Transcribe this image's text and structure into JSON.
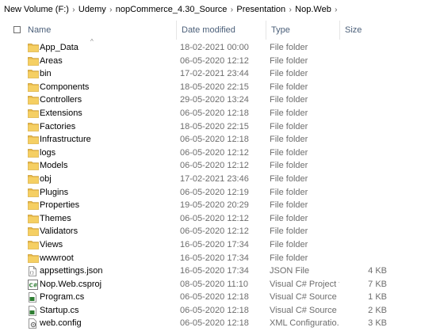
{
  "breadcrumb": [
    "New Volume (F:)",
    "Udemy",
    "nopCommerce_4.30_Source",
    "Presentation",
    "Nop.Web"
  ],
  "columns": {
    "name": "Name",
    "date": "Date modified",
    "type": "Type",
    "size": "Size"
  },
  "colors": {
    "folder": "#e8b94a",
    "header_text": "#4c607a",
    "meta_text": "#6d6d6d"
  },
  "files": [
    {
      "name": "App_Data",
      "date": "18-02-2021 00:00",
      "type": "File folder",
      "size": "",
      "icon": "folder-icon"
    },
    {
      "name": "Areas",
      "date": "06-05-2020 12:12",
      "type": "File folder",
      "size": "",
      "icon": "folder-icon"
    },
    {
      "name": "bin",
      "date": "17-02-2021 23:44",
      "type": "File folder",
      "size": "",
      "icon": "folder-icon"
    },
    {
      "name": "Components",
      "date": "18-05-2020 22:15",
      "type": "File folder",
      "size": "",
      "icon": "folder-icon"
    },
    {
      "name": "Controllers",
      "date": "29-05-2020 13:24",
      "type": "File folder",
      "size": "",
      "icon": "folder-icon"
    },
    {
      "name": "Extensions",
      "date": "06-05-2020 12:18",
      "type": "File folder",
      "size": "",
      "icon": "folder-icon"
    },
    {
      "name": "Factories",
      "date": "18-05-2020 22:15",
      "type": "File folder",
      "size": "",
      "icon": "folder-icon"
    },
    {
      "name": "Infrastructure",
      "date": "06-05-2020 12:18",
      "type": "File folder",
      "size": "",
      "icon": "folder-icon"
    },
    {
      "name": "logs",
      "date": "06-05-2020 12:12",
      "type": "File folder",
      "size": "",
      "icon": "folder-icon"
    },
    {
      "name": "Models",
      "date": "06-05-2020 12:12",
      "type": "File folder",
      "size": "",
      "icon": "folder-icon"
    },
    {
      "name": "obj",
      "date": "17-02-2021 23:46",
      "type": "File folder",
      "size": "",
      "icon": "folder-icon"
    },
    {
      "name": "Plugins",
      "date": "06-05-2020 12:19",
      "type": "File folder",
      "size": "",
      "icon": "folder-icon"
    },
    {
      "name": "Properties",
      "date": "19-05-2020 20:29",
      "type": "File folder",
      "size": "",
      "icon": "folder-icon"
    },
    {
      "name": "Themes",
      "date": "06-05-2020 12:12",
      "type": "File folder",
      "size": "",
      "icon": "folder-icon"
    },
    {
      "name": "Validators",
      "date": "06-05-2020 12:12",
      "type": "File folder",
      "size": "",
      "icon": "folder-icon"
    },
    {
      "name": "Views",
      "date": "16-05-2020 17:34",
      "type": "File folder",
      "size": "",
      "icon": "folder-icon"
    },
    {
      "name": "wwwroot",
      "date": "16-05-2020 17:34",
      "type": "File folder",
      "size": "",
      "icon": "folder-icon"
    },
    {
      "name": "appsettings.json",
      "date": "16-05-2020 17:34",
      "type": "JSON File",
      "size": "4 KB",
      "icon": "json-file-icon"
    },
    {
      "name": "Nop.Web.csproj",
      "date": "08-05-2020 11:10",
      "type": "Visual C# Project f...",
      "size": "7 KB",
      "icon": "csproj-file-icon"
    },
    {
      "name": "Program.cs",
      "date": "06-05-2020 12:18",
      "type": "Visual C# Source F...",
      "size": "1 KB",
      "icon": "csharp-file-icon"
    },
    {
      "name": "Startup.cs",
      "date": "06-05-2020 12:18",
      "type": "Visual C# Source F...",
      "size": "2 KB",
      "icon": "csharp-file-icon"
    },
    {
      "name": "web.config",
      "date": "06-05-2020 12:18",
      "type": "XML Configuratio...",
      "size": "3 KB",
      "icon": "config-file-icon"
    }
  ]
}
